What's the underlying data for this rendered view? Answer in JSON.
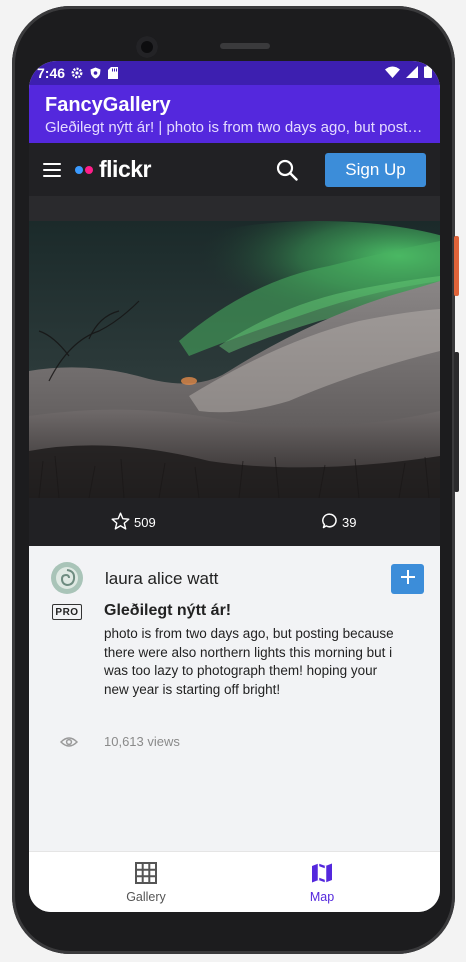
{
  "status_bar": {
    "time": "7:46"
  },
  "app_bar": {
    "title": "FancyGallery",
    "subtitle": "Gleðilegt nýtt ár! | photo is from two days ago, but posting because there were also northern lights this morning but i was too lazy to photograph them! hoping your new year is starting off bright!"
  },
  "flickr_header": {
    "logo_text": "flickr",
    "signup_label": "Sign Up"
  },
  "stats": {
    "faves": "509",
    "comments": "39"
  },
  "post": {
    "username": "laura alice watt",
    "pro_badge": "PRO",
    "title": "Gleðilegt nýtt ár!",
    "description": "photo is from two days ago, but posting because there were also northern lights this morning but i was too lazy to photograph them! hoping your new year is starting off bright!",
    "views": "10,613 views"
  },
  "bottom_nav": {
    "items": [
      {
        "label": "Gallery",
        "icon": "grid-icon",
        "selected": false
      },
      {
        "label": "Map",
        "icon": "map-icon",
        "selected": true
      }
    ]
  },
  "colors": {
    "status_bar": "#3d1fb0",
    "app_bar": "#5428dd",
    "flickr_header": "#212124",
    "signup_button": "#3c8dd9",
    "selected_nav": "#5428dd"
  }
}
